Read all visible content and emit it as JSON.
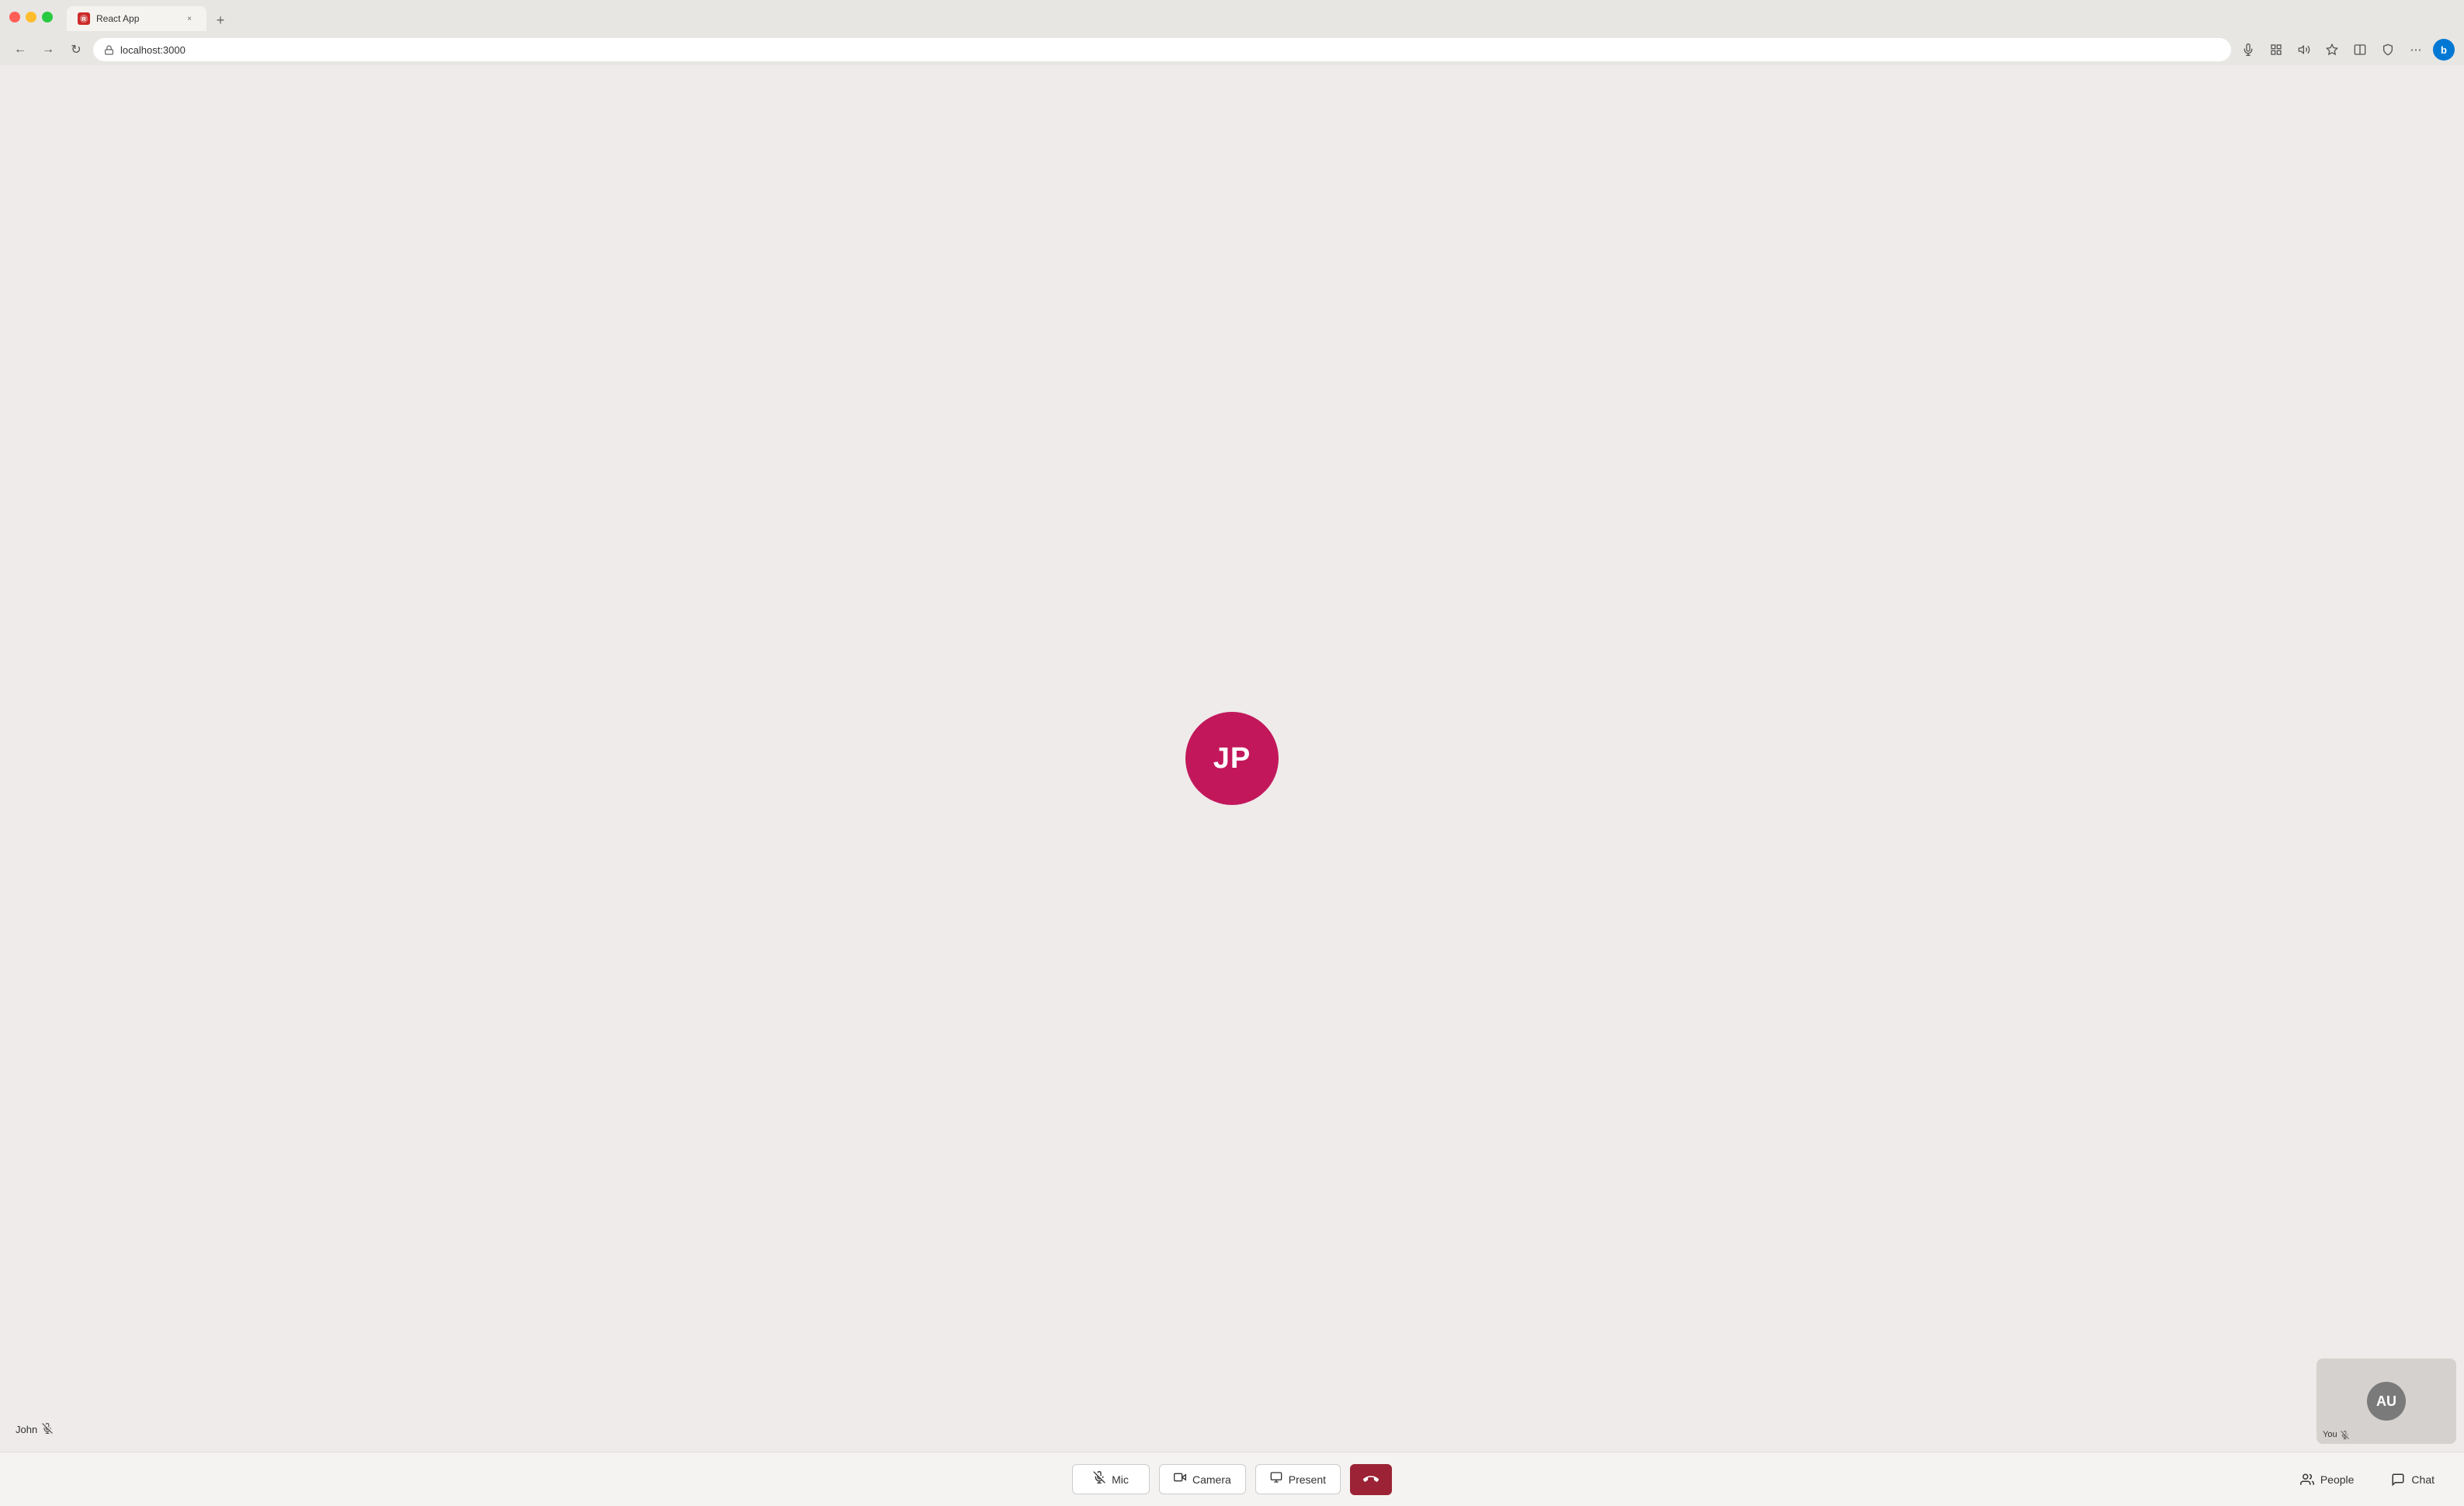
{
  "browser": {
    "tab_title": "React App",
    "tab_favicon_text": "R",
    "url": "localhost:3000",
    "close_label": "×",
    "new_tab_label": "+"
  },
  "main_participant": {
    "initials": "JP",
    "name": "John",
    "avatar_bg": "#c2185b",
    "muted": true
  },
  "self_view": {
    "initials": "AU",
    "label": "You",
    "muted": true,
    "avatar_bg": "#7a7a7a"
  },
  "controls": {
    "mic_label": "Mic",
    "camera_label": "Camera",
    "present_label": "Present",
    "end_call_icon": "📞",
    "people_label": "People",
    "chat_label": "Chat"
  }
}
